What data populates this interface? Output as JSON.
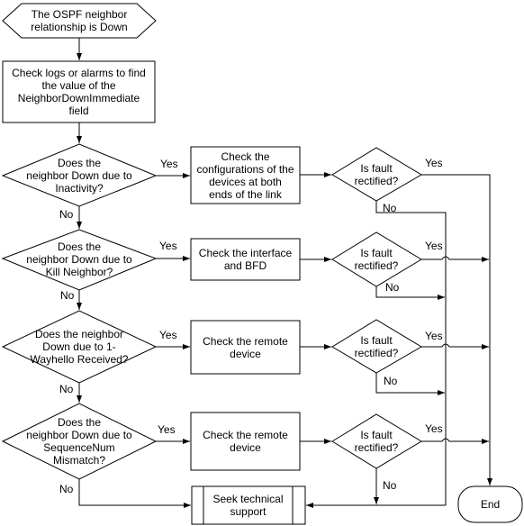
{
  "diagram": {
    "start": "The OSPF neighbor\nrelationship is Down",
    "check_logs": "Check logs or alarms to find\nthe value of the\nNeighborDownImmediate\nfield",
    "questions": [
      {
        "text": "Does the\nneighbor Down due to\nInactivity?",
        "action": "Check the\nconfigurations of the\ndevices at both\nends of the link"
      },
      {
        "text": "Does the\nneighbor Down due to\nKill Neighbor?",
        "action": "Check the interface\nand BFD"
      },
      {
        "text": "Does the neighbor\nDown due to 1-\nWayhello Received?",
        "action": "Check the remote\ndevice"
      },
      {
        "text": "Does the\nneighbor Down due to\nSequenceNum\nMismatch?",
        "action": "Check the remote\ndevice"
      }
    ],
    "fault_question": "Is fault\nrectified?",
    "yes": "Yes",
    "no": "No",
    "support": "Seek technical\nsupport",
    "end": "End"
  }
}
